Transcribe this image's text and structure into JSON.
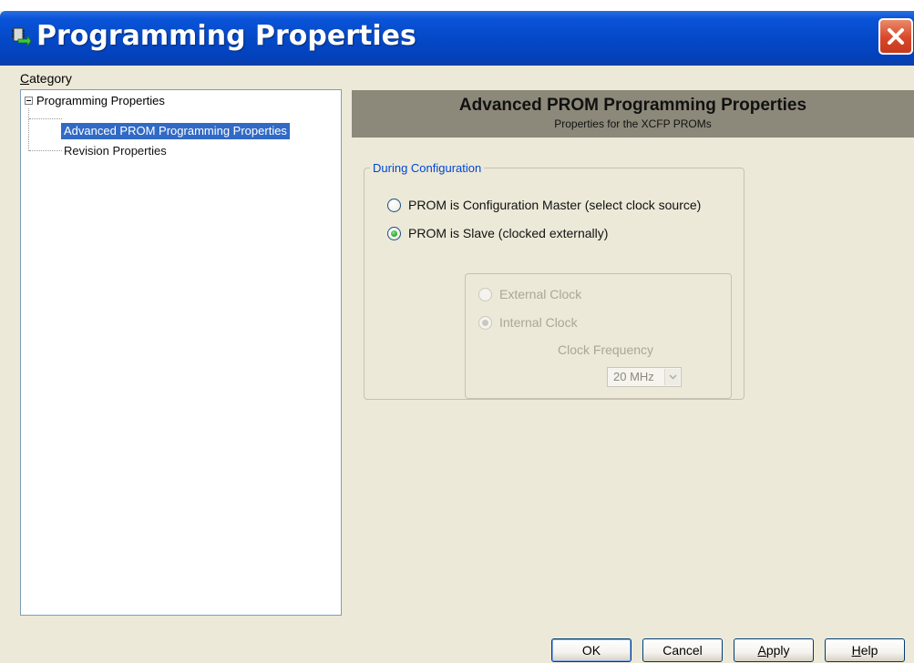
{
  "window": {
    "title": "Programming Properties"
  },
  "category": {
    "label_accel": "C",
    "label_rest": "ategory"
  },
  "tree": {
    "root": "Programming Properties",
    "items": [
      {
        "label": "Advanced PROM Programming Properties",
        "selected": true
      },
      {
        "label": "Revision Properties",
        "selected": false
      }
    ]
  },
  "panel": {
    "title": "Advanced PROM Programming Properties",
    "subtitle": "Properties for the XCFP PROMs"
  },
  "during_configuration": {
    "legend": "During Configuration",
    "options": [
      {
        "label": "PROM is Configuration Master (select clock source)",
        "checked": false
      },
      {
        "label": "PROM is Slave (clocked externally)",
        "checked": true
      }
    ]
  },
  "clock_source": {
    "options": [
      {
        "label": "External Clock",
        "checked": false,
        "enabled": false
      },
      {
        "label": "Internal Clock",
        "checked": true,
        "enabled": false
      }
    ],
    "frequency_label": "Clock Frequency",
    "frequency_value": "20 MHz"
  },
  "buttons": {
    "ok": "OK",
    "cancel": "Cancel",
    "apply_accel": "A",
    "apply_rest": "pply",
    "help_accel": "H",
    "help_rest": "elp"
  },
  "colors": {
    "titlebar": "#0449c8",
    "dialog_bg": "#ece9d8",
    "selection": "#316ac5",
    "header_band": "#8d897a",
    "legend": "#0046d5",
    "close": "#d8462a"
  }
}
